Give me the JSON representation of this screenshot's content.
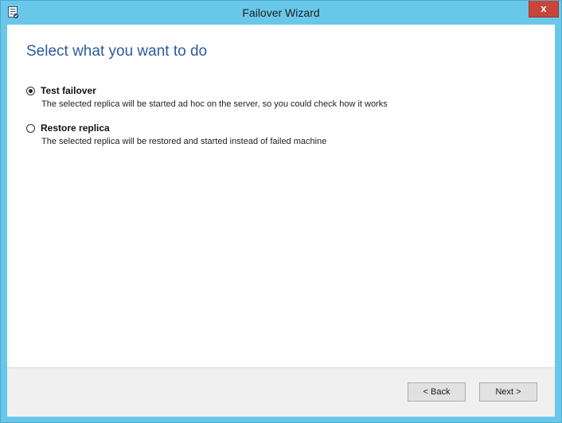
{
  "window": {
    "title": "Failover Wizard",
    "close_glyph": "x"
  },
  "page": {
    "heading": "Select what you want to do"
  },
  "options": [
    {
      "label": "Test failover",
      "description": "The selected replica will be started ad hoc on the server, so you could check how it works",
      "selected": true
    },
    {
      "label": "Restore replica",
      "description": "The selected replica will be restored and started instead of failed machine",
      "selected": false
    }
  ],
  "footer": {
    "back_label": "< Back",
    "next_label": "Next >"
  },
  "icons": {
    "app": "wizard-app-icon",
    "close": "close-icon"
  },
  "colors": {
    "title_bar": "#69c8ea",
    "heading": "#2c5b9c",
    "close_button": "#c7463a",
    "footer": "#f0f0f0"
  }
}
